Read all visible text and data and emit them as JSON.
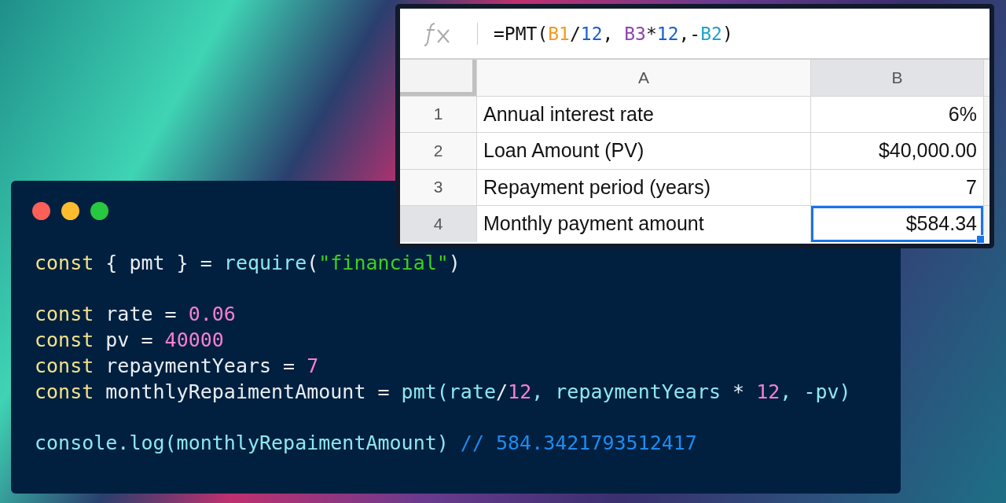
{
  "code_window": {
    "code_blocks": [
      [
        [
          {
            "kind": "keyword",
            "text": "const"
          },
          {
            "kind": "plain",
            "text": " { pmt } = "
          },
          {
            "kind": "func",
            "text": "require"
          },
          {
            "kind": "plain",
            "text": "("
          },
          {
            "kind": "string",
            "text": "\"financial\""
          },
          {
            "kind": "plain",
            "text": ")"
          }
        ]
      ],
      [
        [
          {
            "kind": "keyword",
            "text": "const"
          },
          {
            "kind": "plain",
            "text": " rate = "
          },
          {
            "kind": "number",
            "text": "0.06"
          }
        ],
        [
          {
            "kind": "keyword",
            "text": "const"
          },
          {
            "kind": "plain",
            "text": " pv = "
          },
          {
            "kind": "number",
            "text": "40000"
          }
        ],
        [
          {
            "kind": "keyword",
            "text": "const"
          },
          {
            "kind": "plain",
            "text": " repaymentYears = "
          },
          {
            "kind": "number",
            "text": "7"
          }
        ],
        [
          {
            "kind": "keyword",
            "text": "const"
          },
          {
            "kind": "plain",
            "text": " monthlyRepaimentAmount = "
          },
          {
            "kind": "func",
            "text": "pmt(rate"
          },
          {
            "kind": "plain",
            "text": "/"
          },
          {
            "kind": "number",
            "text": "12"
          },
          {
            "kind": "func",
            "text": ", repaymentYears "
          },
          {
            "kind": "plain",
            "text": "* "
          },
          {
            "kind": "number",
            "text": "12"
          },
          {
            "kind": "func",
            "text": ", -pv)"
          }
        ]
      ],
      [
        [
          {
            "kind": "func",
            "text": "console.log(monthlyRepaimentAmount)"
          },
          {
            "kind": "comment",
            "text": "// 584.3421793512417"
          }
        ]
      ]
    ]
  },
  "spreadsheet": {
    "formula": [
      {
        "text": "=PMT(",
        "color": "#111111"
      },
      {
        "text": "B1",
        "color": "#f39a1e"
      },
      {
        "text": "/",
        "color": "#111111"
      },
      {
        "text": "12",
        "color": "#1a5fd0"
      },
      {
        "text": ", ",
        "color": "#111111"
      },
      {
        "text": "B3",
        "color": "#8e44ad"
      },
      {
        "text": "*",
        "color": "#111111"
      },
      {
        "text": "12",
        "color": "#1a5fd0"
      },
      {
        "text": ",-",
        "color": "#111111"
      },
      {
        "text": "B2",
        "color": "#1ea4c8"
      },
      {
        "text": ")",
        "color": "#111111"
      }
    ],
    "columns": [
      {
        "label": "A",
        "selected": false
      },
      {
        "label": "B",
        "selected": true
      }
    ],
    "rows": [
      {
        "number": "1",
        "label": "Annual interest rate",
        "value": "6%",
        "selected": false
      },
      {
        "number": "2",
        "label": "Loan Amount (PV)",
        "value": "$40,000.00",
        "selected": false
      },
      {
        "number": "3",
        "label": "Repayment period (years)",
        "value": "7",
        "selected": false
      },
      {
        "number": "4",
        "label": "Monthly payment amount",
        "value": "$584.34",
        "selected": true
      }
    ]
  }
}
